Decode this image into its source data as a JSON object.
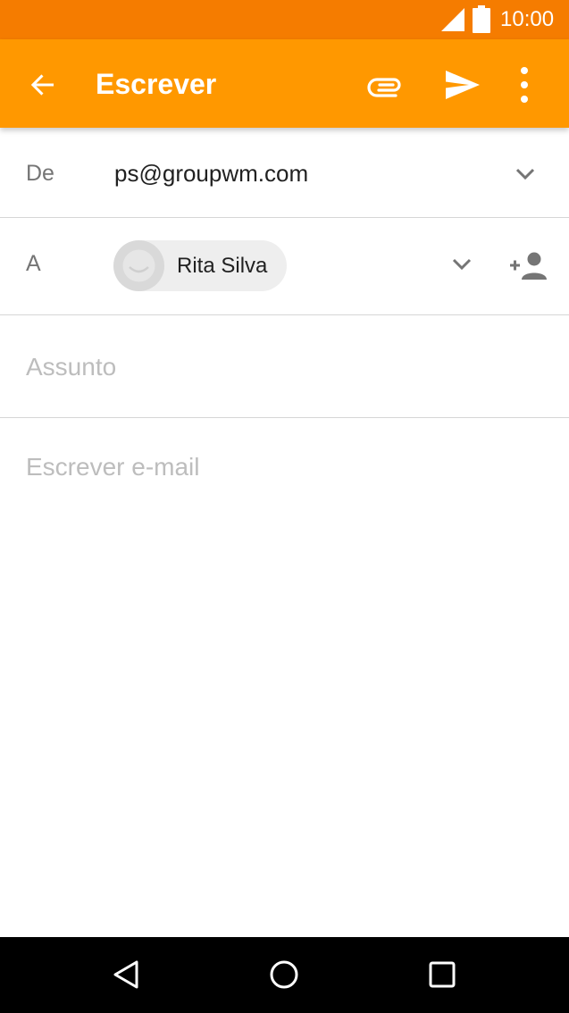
{
  "status_bar": {
    "time": "10:00",
    "icons": [
      "signal-icon",
      "battery-icon"
    ]
  },
  "app_bar": {
    "title": "Escrever",
    "actions": [
      "back-arrow-icon",
      "attach-icon",
      "send-icon",
      "more-vert-icon"
    ]
  },
  "compose": {
    "from": {
      "label": "De",
      "value": "ps@groupwm.com"
    },
    "to": {
      "label": "A",
      "recipients": [
        {
          "name": "Rita Silva"
        }
      ]
    },
    "subject": {
      "value": "",
      "placeholder": "Assunto"
    },
    "body": {
      "value": "",
      "placeholder": "Escrever e-mail"
    }
  },
  "nav_bar": {
    "buttons": [
      "back-triangle-icon",
      "home-circle-icon",
      "recents-square-icon"
    ]
  },
  "colors": {
    "status_bar": "#F57C00",
    "app_bar": "#FF9800",
    "text_primary": "#212121",
    "text_secondary": "#757575",
    "placeholder": "#BDBDBD",
    "divider": "#D6D6D6",
    "nav_bar": "#000000"
  }
}
